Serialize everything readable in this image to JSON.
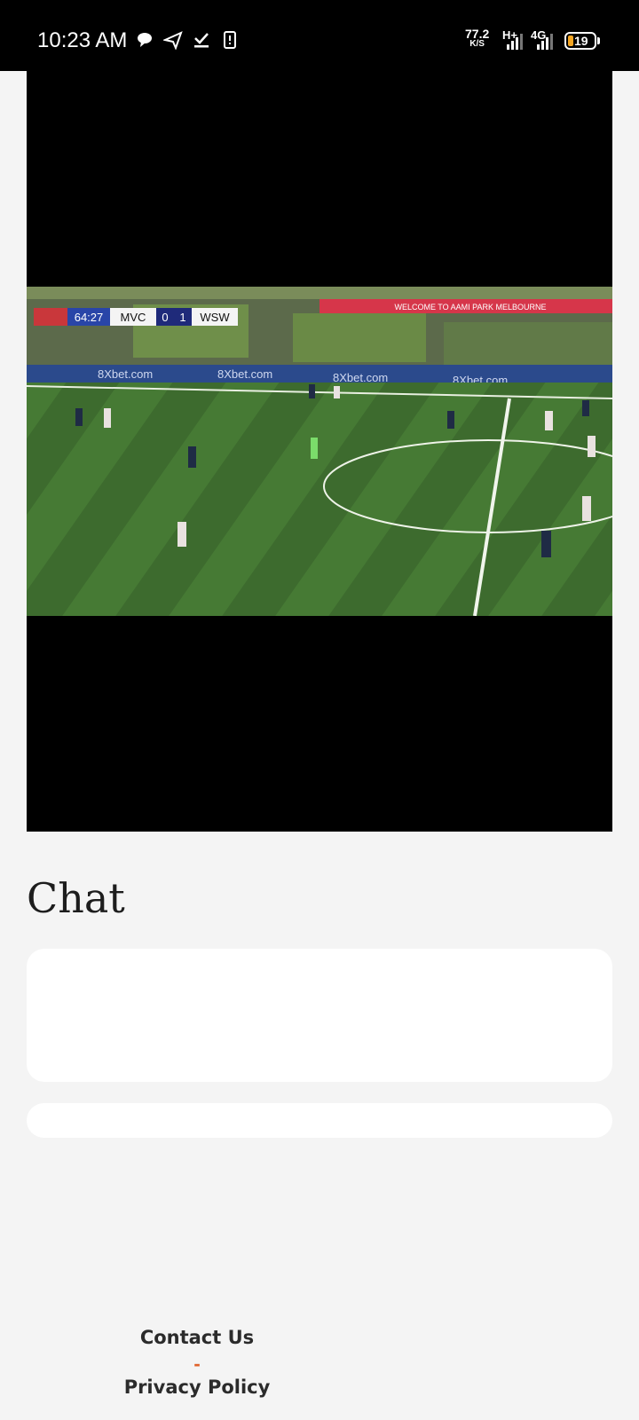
{
  "status_bar": {
    "time": "10:23 AM",
    "net_speed_value": "77.2",
    "net_speed_unit": "K/S",
    "network_type_1": "H+",
    "network_type_2": "4G",
    "battery_level": "19",
    "icons": [
      "chat-bubble-icon",
      "send-icon",
      "download-done-icon",
      "phone-alert-icon"
    ]
  },
  "video": {
    "scoreboard": {
      "clock": "64:27",
      "home": "MVC",
      "home_score": "0",
      "away_score": "1",
      "away": "WSW"
    },
    "ad_board": "8Xbet.com",
    "banner": "WELCOME TO AAMI PARK MELBOURNE"
  },
  "chat": {
    "heading": "Chat",
    "input_placeholder": ""
  },
  "footer": {
    "contact_label": "Contact Us",
    "separator": "-",
    "privacy_label": "Privacy Policy"
  }
}
